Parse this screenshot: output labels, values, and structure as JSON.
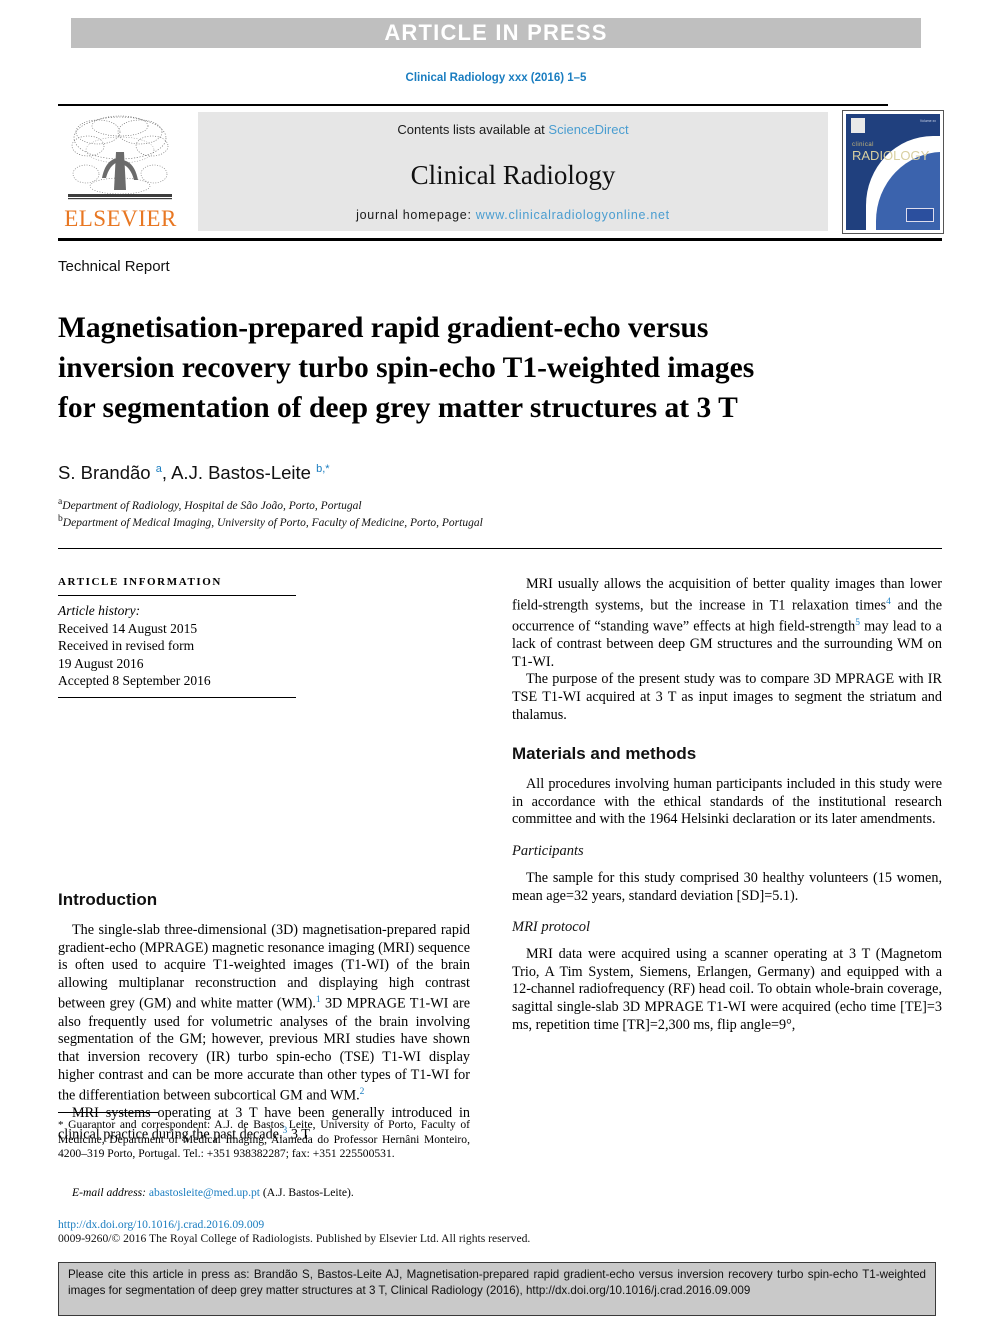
{
  "banner": {
    "label": "ARTICLE IN PRESS"
  },
  "running_head": "Clinical Radiology xxx (2016) 1–5",
  "masthead": {
    "publisher_name": "ELSEVIER",
    "contents_prefix": "Contents lists available at ",
    "contents_link": "ScienceDirect",
    "journal_name": "Clinical Radiology",
    "homepage_prefix": "journal homepage: ",
    "homepage_url": "www.clinicalradiologyonline.net",
    "cover": {
      "title_small": "clinical",
      "title_large": "RADIOLOGY",
      "corner_note": "Volume xx"
    }
  },
  "article": {
    "type": "Technical Report",
    "title": "Magnetisation-prepared rapid gradient-echo versus inversion recovery turbo spin-echo T1-weighted images for segmentation of deep grey matter structures at 3 T",
    "authors_html": "S. Brandão <sup>a</sup>, A.J. Bastos-Leite <sup>b,*</sup>",
    "affiliation_a_marker": "a",
    "affiliation_a": "Department of Radiology, Hospital de São João, Porto, Portugal",
    "affiliation_b_marker": "b",
    "affiliation_b": "Department of Medical Imaging, University of Porto, Faculty of Medicine, Porto, Portugal"
  },
  "article_information": {
    "heading": "ARTICLE INFORMATION",
    "history_label": "Article history:",
    "received": "Received 14 August 2015",
    "revised_label": "Received in revised form",
    "revised_date": "19 August 2016",
    "accepted": "Accepted 8 September 2016"
  },
  "sections": {
    "introduction_heading": "Introduction",
    "intro_p1_html": "The single-slab three-dimensional (3D) magnetisation-prepared rapid gradient-echo (MPRAGE) magnetic resonance imaging (MRI) sequence is often used to acquire T1-weighted images (T1-WI) of the brain allowing multiplanar reconstruction and displaying high contrast between grey (GM) and white matter (WM).<sup>1</sup> 3D MPRAGE T1-WI are also frequently used for volumetric analyses of the brain involving segmentation of the GM; however, previous MRI studies have shown that inversion recovery (IR) turbo spin-echo (TSE) T1-WI display higher contrast and can be more accurate than other types of T1-WI for the differentiation between subcortical GM and WM.<sup>2</sup>",
    "intro_p2_html": "MRI systems operating at 3 T have been generally introduced in clinical practice during the past decade.<sup>3</sup> 3 T",
    "right_p1_html": "MRI usually allows the acquisition of better quality images than lower field-strength systems, but the increase in T1 relaxation times<sup>4</sup> and the occurrence of “standing wave” effects at high field-strength<sup>5</sup> may lead to a lack of contrast between deep GM structures and the surrounding WM on T1-WI.",
    "right_p2_html": "The purpose of the present study was to compare 3D MPRAGE with IR TSE T1-WI acquired at 3 T as input images to segment the striatum and thalamus.",
    "materials_heading": "Materials and methods",
    "materials_p1_html": "All procedures involving human participants included in this study were in accordance with the ethical standards of the institutional research committee and with the 1964 Helsinki declaration or its later amendments.",
    "participants_heading": "Participants",
    "participants_p1_html": "The sample for this study comprised 30 healthy volunteers (15 women, mean age=32 years, standard deviation [SD]=5.1).",
    "mri_protocol_heading": "MRI protocol",
    "mri_protocol_p1_html": "MRI data were acquired using a scanner operating at 3 T (Magnetom Trio, A Tim System, Siemens, Erlangen, Germany) and equipped with a 12-channel radiofrequency (RF) head coil. To obtain whole-brain coverage, sagittal single-slab 3D MPRAGE T1-WI were acquired (echo time [TE]=3 ms, repetition time [TR]=2,300 ms, flip angle=9°,"
  },
  "footnote": {
    "text_html": "<span class=\"star\">*</span> Guarantor and correspondent: A.J. de Bastos Leite, University of Porto, Faculty of Medicine, Department of Medical Imaging, Alameda do Professor Hernâni Monteiro, 4200–319 Porto, Portugal. Tel.: +351 938382287; fax: +351 225500531.",
    "email_label": "E-mail address:",
    "email_address": "abastosleite@med.up.pt",
    "email_owner": "(A.J. Bastos-Leite)."
  },
  "doi": "http://dx.doi.org/10.1016/j.crad.2016.09.009",
  "copyright": "0009-9260/© 2016 The Royal College of Radiologists. Published by Elsevier Ltd. All rights reserved.",
  "cite_box": {
    "text": "Please cite this article in press as: Brandão S, Bastos-Leite AJ, Magnetisation-prepared rapid gradient-echo versus inversion recovery turbo spin-echo T1-weighted images for segmentation of deep grey matter structures at 3 T, Clinical Radiology (2016), http://dx.doi.org/10.1016/j.crad.2016.09.009"
  },
  "colors": {
    "link_blue": "#1a7dc0",
    "sciencedirect_blue": "#4a9dd0",
    "elsevier_orange": "#e87722",
    "banner_grey": "#bfbfbf",
    "band_grey": "#e6e6e6",
    "cite_box_grey": "#c9c9c9",
    "cover_navy": "#20407e"
  }
}
